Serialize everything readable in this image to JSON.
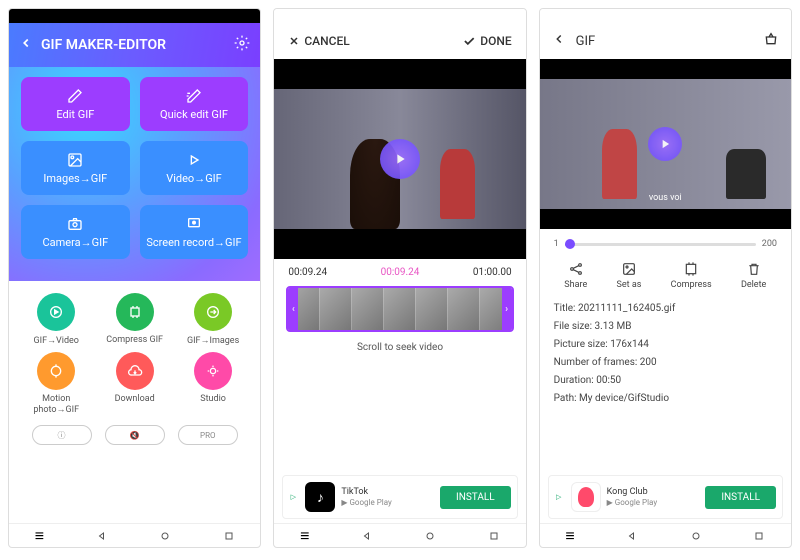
{
  "screen1": {
    "title": "GIF MAKER-EDITOR",
    "tiles": {
      "edit": "Edit GIF",
      "quick": "Quick edit GIF",
      "images": "Images→GIF",
      "video": "Video→GIF",
      "camera": "Camera→GIF",
      "screen": "Screen record→GIF"
    },
    "circles": {
      "gif2video": "GIF→Video",
      "compress": "Compress GIF",
      "gif2images": "GIF→Images",
      "motion": "Motion photo→GIF",
      "download": "Download",
      "studio": "Studio"
    },
    "pills": {
      "info": "ⓘ",
      "mute": "🔇",
      "pro": "PRO"
    }
  },
  "screen2": {
    "cancel": "CANCEL",
    "done": "DONE",
    "times": {
      "start": "00:09.24",
      "current": "00:09.24",
      "end": "01:00.00"
    },
    "scroll_hint": "Scroll to seek video",
    "ad": {
      "title": "TikTok",
      "sub": "Google Play",
      "cta": "INSTALL"
    }
  },
  "screen3": {
    "title": "GIF",
    "slider": {
      "min": "1",
      "max": "200"
    },
    "actions": {
      "share": "Share",
      "setas": "Set as",
      "compress": "Compress",
      "delete": "Delete"
    },
    "info": {
      "title_label": "Title:",
      "title_val": "20211111_162405.gif",
      "size_label": "File size:",
      "size_val": "3.13 MB",
      "pic_label": "Picture size:",
      "pic_val": "176x144",
      "frames_label": "Number of frames:",
      "frames_val": "200",
      "dur_label": "Duration:",
      "dur_val": "00:50",
      "path_label": "Path:",
      "path_val": "My device/GifStudio"
    },
    "caption": "vous voi",
    "ad": {
      "title": "Kong Club",
      "sub": "Google Play",
      "cta": "INSTALL"
    }
  }
}
